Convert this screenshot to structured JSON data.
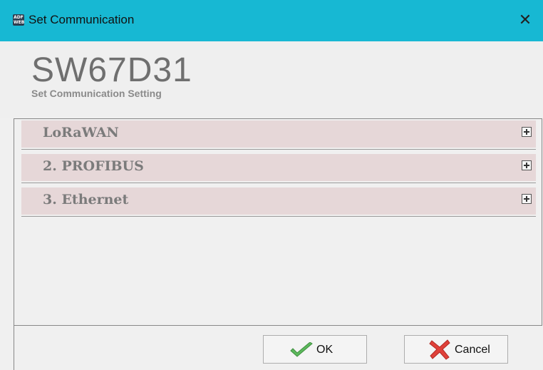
{
  "window": {
    "title": "Set Communication",
    "logo_text": "ADF WEB",
    "close_icon": "close-icon"
  },
  "header": {
    "product_code": "SW67D31",
    "subtitle": "Set Communication Setting"
  },
  "sections": [
    {
      "label": "LoRaWAN",
      "icon": "expand-plus-icon"
    },
    {
      "label": "2. PROFIBUS",
      "icon": "expand-plus-icon"
    },
    {
      "label": "3. Ethernet",
      "icon": "expand-plus-icon"
    }
  ],
  "buttons": {
    "ok_label": "OK",
    "ok_icon": "checkmark-icon",
    "cancel_label": "Cancel",
    "cancel_icon": "red-x-icon"
  },
  "colors": {
    "titlebar": "#17b8d3",
    "section_bar": "#e6d7d8",
    "ok_check": "#5cb85c",
    "cancel_x": "#e0413a"
  }
}
